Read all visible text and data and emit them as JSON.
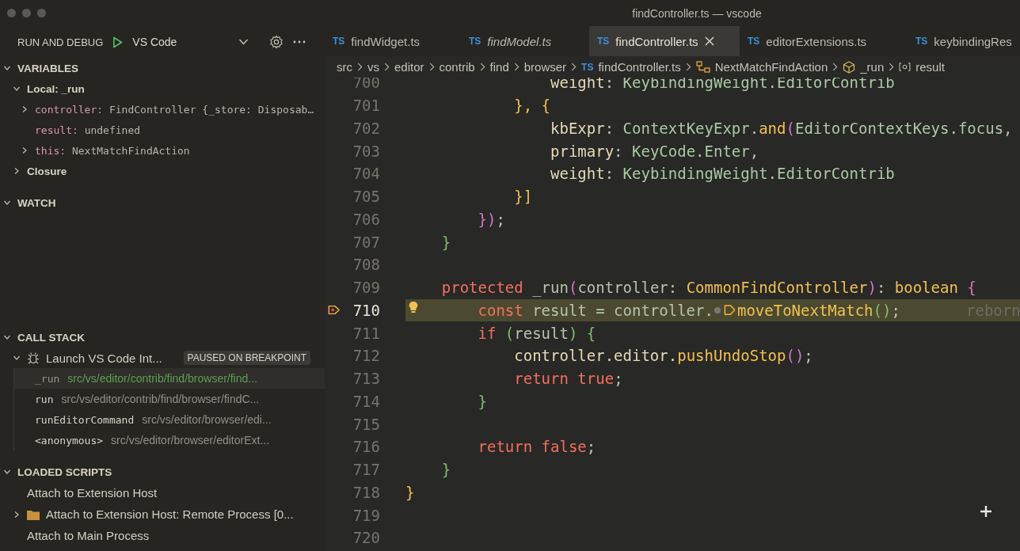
{
  "window": {
    "title": "findController.ts — vscode"
  },
  "sidebar": {
    "title": "RUN AND DEBUG",
    "configuration": "VS Code",
    "sections": [
      {
        "title": "VARIABLES",
        "expanded": true,
        "kind": "variables"
      },
      {
        "title": "WATCH",
        "expanded": true,
        "kind": "watch"
      },
      {
        "title": "CALL STACK",
        "expanded": true,
        "kind": "callstack"
      },
      {
        "title": "LOADED SCRIPTS",
        "expanded": true,
        "kind": "scripts"
      }
    ]
  },
  "variables": {
    "scopes": [
      {
        "name": "Local: _run",
        "expanded": true,
        "children": [
          {
            "name": "controller:",
            "value": "FindController {_store: Disposab…",
            "kind": "object",
            "expanded": false
          },
          {
            "name": "result:",
            "value": "undefined",
            "kind": "primitive"
          },
          {
            "name": "this:",
            "value": "NextMatchFindAction",
            "kind": "object",
            "expanded": false
          }
        ]
      },
      {
        "name": "Closure",
        "expanded": false
      }
    ]
  },
  "call_stack": {
    "session": "Launch VS Code Int...",
    "expanded": true,
    "badge": "PAUSED ON BREAKPOINT",
    "frames": [
      {
        "name": "_run",
        "source": "src/vs/editor/contrib/find/browser/find...",
        "selected": true
      },
      {
        "name": "run",
        "source": "src/vs/editor/contrib/find/browser/findC...",
        "selected": false
      },
      {
        "name": "runEditorCommand",
        "source": "src/vs/editor/browser/edi...",
        "selected": false
      },
      {
        "name": "<anonymous>",
        "source": "src/vs/editor/browser/editorExt...",
        "selected": false
      }
    ]
  },
  "loaded_scripts": [
    {
      "label": "Attach to Extension Host",
      "kind": "item"
    },
    {
      "label": "Attach to Extension Host: Remote Process [0...",
      "kind": "folder",
      "expanded": false
    },
    {
      "label": "Attach to Main Process",
      "kind": "item"
    }
  ],
  "tabs": [
    {
      "icon": "TS",
      "label": "findWidget.ts",
      "preview": false,
      "selected": false
    },
    {
      "icon": "TS",
      "label": "findModel.ts",
      "preview": true,
      "selected": false
    },
    {
      "icon": "TS",
      "label": "findController.ts",
      "preview": false,
      "selected": true
    },
    {
      "icon": "TS",
      "label": "editorExtensions.ts",
      "preview": false,
      "selected": false
    },
    {
      "icon": "TS",
      "label": "keybindingRes",
      "preview": false,
      "selected": false
    }
  ],
  "breadcrumbs": [
    {
      "kind": "folder",
      "label": "src"
    },
    {
      "kind": "folder",
      "label": "vs"
    },
    {
      "kind": "folder",
      "label": "editor"
    },
    {
      "kind": "folder",
      "label": "contrib"
    },
    {
      "kind": "folder",
      "label": "find"
    },
    {
      "kind": "folder",
      "label": "browser"
    },
    {
      "kind": "file",
      "icon": "TS",
      "label": "findController.ts"
    },
    {
      "kind": "class",
      "label": "NextMatchFindAction"
    },
    {
      "kind": "method",
      "label": "_run"
    },
    {
      "kind": "variable",
      "label": "result"
    }
  ],
  "code": [
    {
      "number": "700",
      "current": false,
      "tokens": [
        {
          "text": "                weight",
          "kind": "prop"
        },
        {
          "text": ": ",
          "kind": "plain"
        },
        {
          "text": "KeybindingWeight",
          "kind": "type"
        },
        {
          "text": ".",
          "kind": "plain"
        },
        {
          "text": "EditorContrib",
          "kind": "type"
        }
      ]
    },
    {
      "number": "701",
      "current": false,
      "tokens": [
        {
          "text": "            }, {",
          "kind": "b1"
        }
      ]
    },
    {
      "number": "702",
      "current": false,
      "tokens": [
        {
          "text": "                kbExpr",
          "kind": "prop"
        },
        {
          "text": ": ",
          "kind": "plain"
        },
        {
          "text": "ContextKeyExpr",
          "kind": "type"
        },
        {
          "text": ".",
          "kind": "plain"
        },
        {
          "text": "and",
          "kind": "fn"
        },
        {
          "text": "(",
          "kind": "b2"
        },
        {
          "text": "EditorContextKeys",
          "kind": "type"
        },
        {
          "text": ".",
          "kind": "plain"
        },
        {
          "text": "focus",
          "kind": "type"
        },
        {
          "text": ",",
          "kind": "plain"
        }
      ]
    },
    {
      "number": "703",
      "current": false,
      "tokens": [
        {
          "text": "                primary",
          "kind": "prop"
        },
        {
          "text": ": ",
          "kind": "plain"
        },
        {
          "text": "KeyCode",
          "kind": "type"
        },
        {
          "text": ".",
          "kind": "plain"
        },
        {
          "text": "Enter",
          "kind": "type"
        },
        {
          "text": ",",
          "kind": "plain"
        }
      ]
    },
    {
      "number": "704",
      "current": false,
      "tokens": [
        {
          "text": "                weight",
          "kind": "prop"
        },
        {
          "text": ": ",
          "kind": "plain"
        },
        {
          "text": "KeybindingWeight",
          "kind": "type"
        },
        {
          "text": ".",
          "kind": "plain"
        },
        {
          "text": "EditorContrib",
          "kind": "type"
        }
      ]
    },
    {
      "number": "705",
      "current": false,
      "tokens": [
        {
          "text": "            }]",
          "kind": "b1"
        }
      ]
    },
    {
      "number": "706",
      "current": false,
      "tokens": [
        {
          "text": "        })",
          "kind": "b2"
        },
        {
          "text": ";",
          "kind": "plain"
        }
      ]
    },
    {
      "number": "707",
      "current": false,
      "tokens": [
        {
          "text": "    }",
          "kind": "b3"
        }
      ]
    },
    {
      "number": "708",
      "current": false
    },
    {
      "number": "709",
      "current": false,
      "tokens": [
        {
          "text": "    protected",
          "kind": "kw"
        },
        {
          "text": " _run",
          "kind": "plain"
        },
        {
          "text": "(",
          "kind": "b2"
        },
        {
          "text": "controller",
          "kind": "plain"
        },
        {
          "text": ": ",
          "kind": "plain"
        },
        {
          "text": "CommonFindController",
          "kind": "fn"
        },
        {
          "text": ")",
          "kind": "b2"
        },
        {
          "text": ": ",
          "kind": "plain"
        },
        {
          "text": "boolean",
          "kind": "fn"
        },
        {
          "text": " {",
          "kind": "b2"
        }
      ]
    },
    {
      "number": "710",
      "current": true,
      "lightbulb": true,
      "ghost": "reborn",
      "tokens": [
        {
          "text": "        const",
          "kind": "kw"
        },
        {
          "text": " result = controller.",
          "kind": "plain"
        },
        {
          "kind": "dot"
        },
        {
          "kind": "inline-breakpoint"
        },
        {
          "text": "moveToNextMatch",
          "kind": "fn"
        },
        {
          "text": "()",
          "kind": "b3"
        },
        {
          "text": ";",
          "kind": "plain"
        }
      ]
    },
    {
      "number": "711",
      "current": false,
      "tokens": [
        {
          "text": "        if",
          "kind": "kw"
        },
        {
          "text": " (",
          "kind": "b3"
        },
        {
          "text": "result",
          "kind": "plain"
        },
        {
          "text": ")",
          "kind": "b3"
        },
        {
          "text": " {",
          "kind": "b3"
        }
      ]
    },
    {
      "number": "712",
      "current": false,
      "tokens": [
        {
          "text": "            controller.editor.",
          "kind": "prop"
        },
        {
          "text": "pushUndoStop",
          "kind": "fn"
        },
        {
          "text": "()",
          "kind": "b2"
        },
        {
          "text": ";",
          "kind": "plain"
        }
      ]
    },
    {
      "number": "713",
      "current": false,
      "tokens": [
        {
          "text": "            return",
          "kind": "kw"
        },
        {
          "text": " true",
          "kind": "kw"
        },
        {
          "text": ";",
          "kind": "plain"
        }
      ]
    },
    {
      "number": "714",
      "current": false,
      "tokens": [
        {
          "text": "        }",
          "kind": "b3"
        }
      ]
    },
    {
      "number": "715",
      "current": false
    },
    {
      "number": "716",
      "current": false,
      "tokens": [
        {
          "text": "        return",
          "kind": "kw"
        },
        {
          "text": " false",
          "kind": "kw"
        },
        {
          "text": ";",
          "kind": "plain"
        }
      ]
    },
    {
      "number": "717",
      "current": false,
      "tokens": [
        {
          "text": "    }",
          "kind": "b3"
        }
      ]
    },
    {
      "number": "718",
      "current": false,
      "tokens": [
        {
          "text": "}",
          "kind": "b1"
        }
      ]
    },
    {
      "number": "719",
      "current": false
    },
    {
      "number": "720",
      "current": false
    }
  ]
}
